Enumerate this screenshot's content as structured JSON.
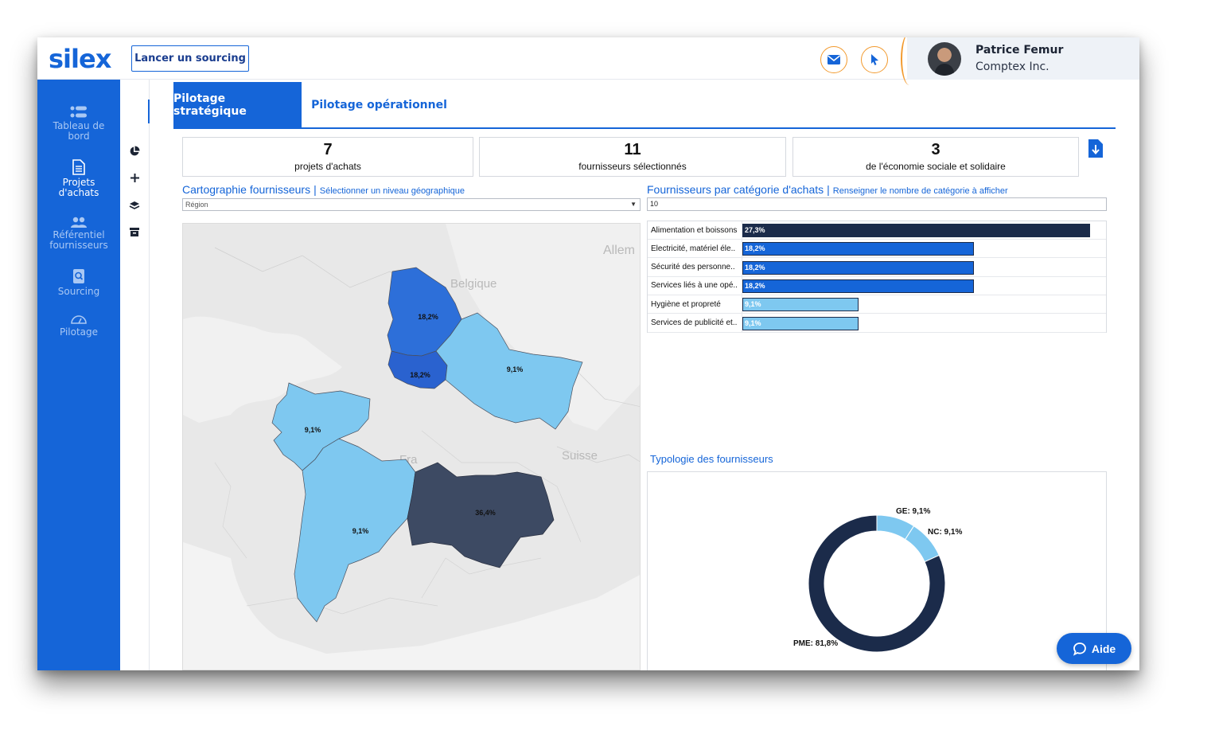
{
  "brand": {
    "logo_text": "silex",
    "primary": "#1565d8",
    "accent": "#f29a2e",
    "dark": "#1b2b4a"
  },
  "header": {
    "launch_label": "Lancer un sourcing",
    "mail_icon": "mail-icon",
    "notify_icon": "cursor-icon",
    "user": {
      "name": "Patrice Femur",
      "company": "Comptex Inc."
    }
  },
  "sidebar": {
    "items": [
      {
        "label_line1": "Tableau de",
        "label_line2": "bord",
        "icon": "dashboard-icon"
      },
      {
        "label_line1": "Projets",
        "label_line2": "d'achats",
        "icon": "document-icon"
      },
      {
        "label_line1": "Référentiel",
        "label_line2": "fournisseurs",
        "icon": "users-icon"
      },
      {
        "label_line1": "Sourcing",
        "label_line2": "",
        "icon": "search-doc-icon"
      },
      {
        "label_line1": "Pilotage",
        "label_line2": "",
        "icon": "gauge-icon"
      }
    ],
    "settings_icon": "gear-icon"
  },
  "subbar": {
    "expand_label": "»"
  },
  "tabs": {
    "strategic": "Pilotage stratégique",
    "operational": "Pilotage opérationnel"
  },
  "kpis": [
    {
      "value": "7",
      "label": "projets d'achats"
    },
    {
      "value": "11",
      "label": "fournisseurs sélectionnés"
    },
    {
      "value": "3",
      "label": "de l'économie sociale et solidaire"
    }
  ],
  "map_section": {
    "title": "Cartographie fournisseurs",
    "sep": "|",
    "subtitle": "Sélectionner un niveau géographique",
    "select_value": "Région",
    "labels": {
      "allemagne": "Allem",
      "belgique": "Belgique",
      "france": "Fra",
      "suisse": "Suisse"
    },
    "regions": [
      {
        "name": "hauts-de-france",
        "value": "18,2%",
        "color": "#2d6fd9"
      },
      {
        "name": "ile-de-france",
        "value": "18,2%",
        "color": "#2a62cf"
      },
      {
        "name": "grand-est",
        "value": "9,1%",
        "color": "#7ec8f0"
      },
      {
        "name": "pays-de-la-loire",
        "value": "9,1%",
        "color": "#7ec8f0"
      },
      {
        "name": "nouvelle-aquitaine",
        "value": "9,1%",
        "color": "#7ec8f0"
      },
      {
        "name": "auvergne-rhone-alpes",
        "value": "36,4%",
        "color": "#3d4a63"
      }
    ]
  },
  "category_section": {
    "title": "Fournisseurs par catégorie d'achats",
    "sep": "|",
    "subtitle": "Renseigner le nombre de catégorie à afficher",
    "input_value": "10"
  },
  "typology": {
    "title": "Typologie des fournisseurs"
  },
  "chart_data": [
    {
      "type": "bar",
      "orientation": "horizontal",
      "categories": [
        "Alimentation et boissons",
        "Electricité, matériel éle..",
        "Sécurité des personne..",
        "Services liés à une opé..",
        "Hygiène et propreté",
        "Services de publicité et.."
      ],
      "values": [
        27.3,
        18.2,
        18.2,
        18.2,
        9.1,
        9.1
      ],
      "value_labels": [
        "27,3%",
        "18,2%",
        "18,2%",
        "18,2%",
        "9,1%",
        "9,1%"
      ],
      "colors": [
        "#1b2b4a",
        "#1565d8",
        "#1565d8",
        "#1565d8",
        "#7ec8f0",
        "#7ec8f0"
      ],
      "xlim": [
        0,
        27.3
      ]
    },
    {
      "type": "pie",
      "style": "donut",
      "categories": [
        "PME",
        "GE",
        "NC"
      ],
      "values": [
        81.8,
        9.1,
        9.1
      ],
      "labels": [
        "PME: 81,8%",
        "GE: 9,1%",
        "NC: 9,1%"
      ],
      "colors": [
        "#1b2b4a",
        "#7ec8f0",
        "#7ec8f0"
      ]
    }
  ],
  "help": {
    "label": "Aide"
  }
}
